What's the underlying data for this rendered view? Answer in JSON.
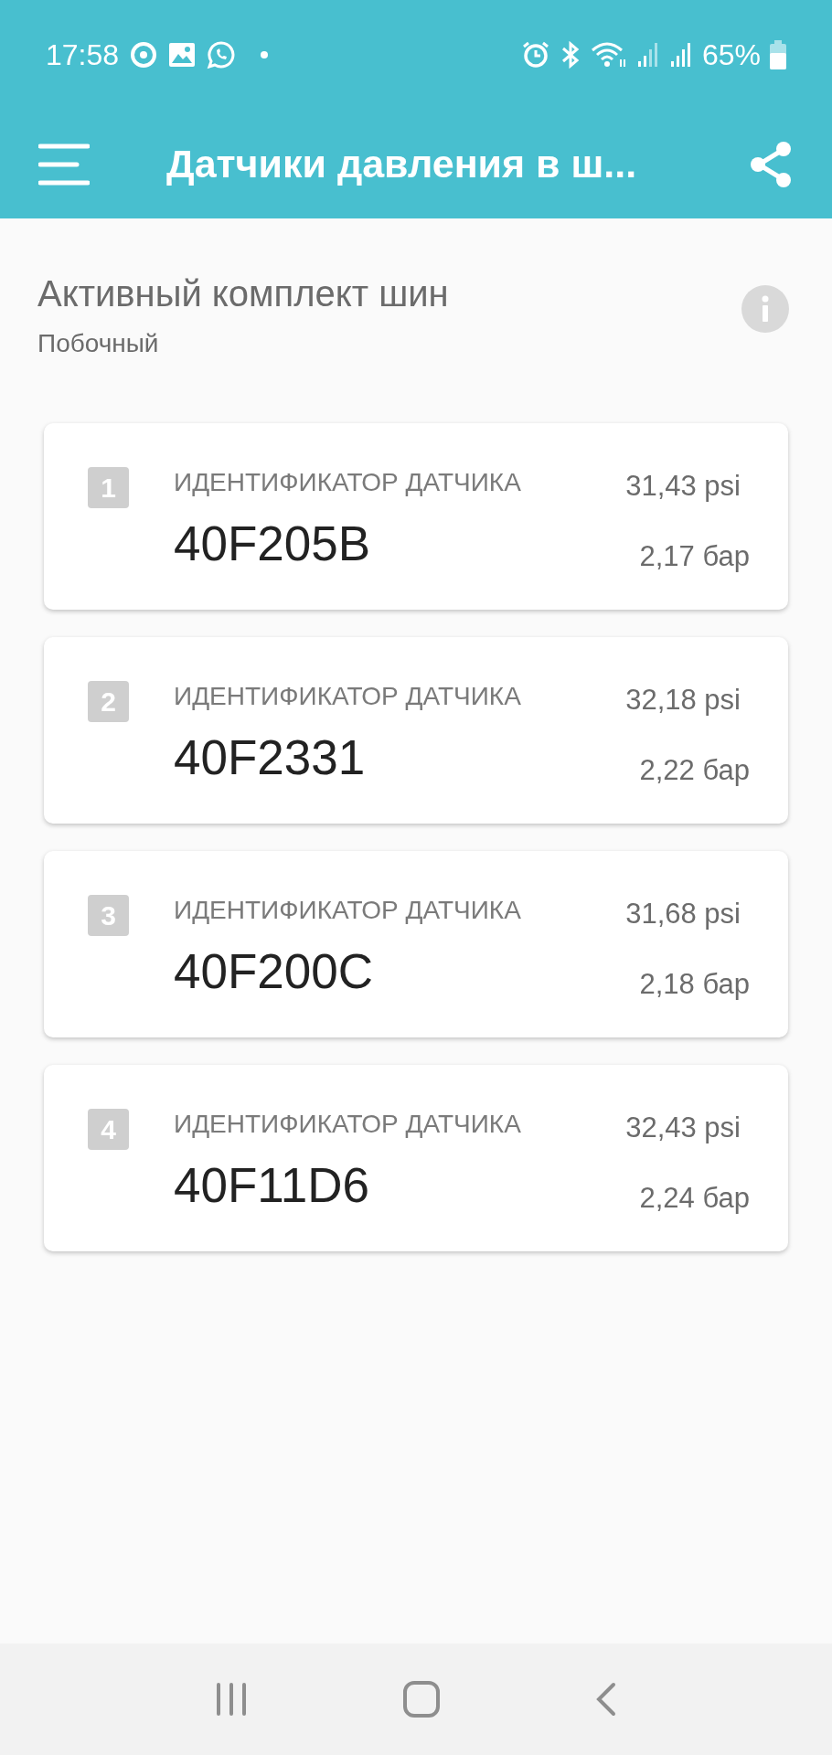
{
  "status_bar": {
    "time": "17:58",
    "battery_text": "65%"
  },
  "app_bar": {
    "title": "Датчики давления в ш..."
  },
  "active_set": {
    "title": "Активный комплект шин",
    "value": "Побочный"
  },
  "sensors": [
    {
      "index": "1",
      "label": "ИДЕНТИФИКАТОР ДАТЧИКА",
      "id": "40F205B",
      "psi": "31,43 psi",
      "bar": "2,17 бар"
    },
    {
      "index": "2",
      "label": "ИДЕНТИФИКАТОР ДАТЧИКА",
      "id": "40F2331",
      "psi": "32,18 psi",
      "bar": "2,22 бар"
    },
    {
      "index": "3",
      "label": "ИДЕНТИФИКАТОР ДАТЧИКА",
      "id": "40F200C",
      "psi": "31,68 psi",
      "bar": "2,18 бар"
    },
    {
      "index": "4",
      "label": "ИДЕНТИФИКАТОР ДАТЧИКА",
      "id": "40F11D6",
      "psi": "32,43 psi",
      "bar": "2,24 бар"
    }
  ]
}
